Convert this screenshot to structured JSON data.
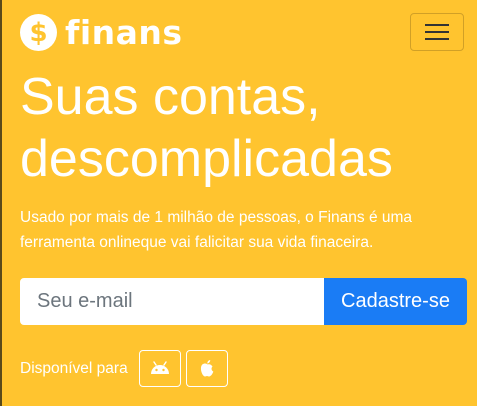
{
  "brand": {
    "logo_symbol": "$",
    "name": "finans"
  },
  "navbar": {
    "toggle_icon": "hamburger-menu-icon"
  },
  "hero": {
    "title": "Suas contas, descomplicadas",
    "subtitle": "Usado por mais de 1 milhão de pessoas, o Finans é uma ferramenta onlineque vai falicitar sua vida finaceira."
  },
  "signup": {
    "email_placeholder": "Seu e-mail",
    "email_value": "",
    "submit_label": "Cadastre-se"
  },
  "apps": {
    "label": "Disponível para",
    "platforms": [
      "android-icon",
      "apple-icon"
    ]
  },
  "colors": {
    "background": "#ffc42f",
    "primary_button": "#1a7cf5",
    "text": "#ffffff"
  }
}
